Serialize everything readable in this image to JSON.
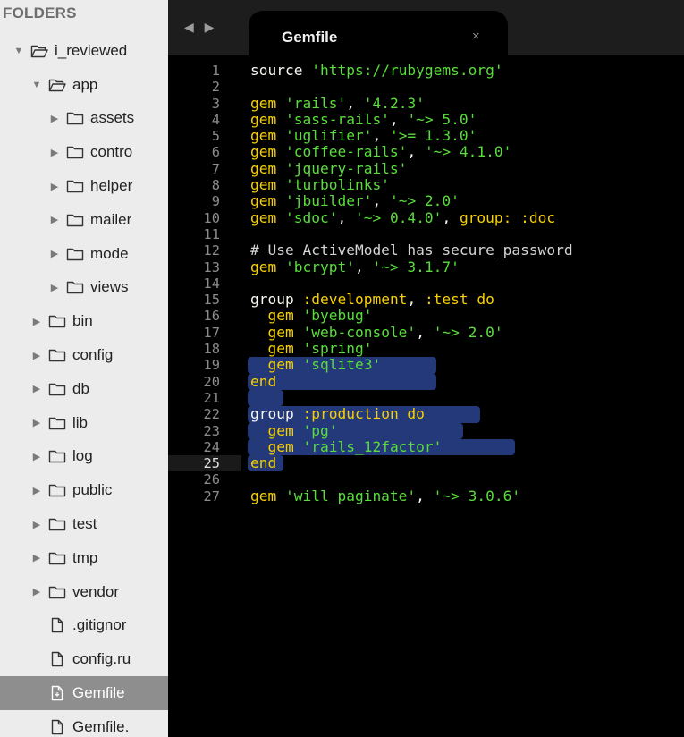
{
  "sidebar": {
    "header": "FOLDERS",
    "items": [
      {
        "label": "i_reviewed",
        "depth": 0,
        "kind": "folder-open",
        "expanded": true
      },
      {
        "label": "app",
        "depth": 1,
        "kind": "folder-open",
        "expanded": true
      },
      {
        "label": "assets",
        "depth": 2,
        "kind": "folder",
        "expanded": false
      },
      {
        "label": "contro",
        "depth": 2,
        "kind": "folder",
        "expanded": false
      },
      {
        "label": "helper",
        "depth": 2,
        "kind": "folder",
        "expanded": false
      },
      {
        "label": "mailer",
        "depth": 2,
        "kind": "folder",
        "expanded": false
      },
      {
        "label": "mode",
        "depth": 2,
        "kind": "folder",
        "expanded": false
      },
      {
        "label": "views",
        "depth": 2,
        "kind": "folder",
        "expanded": false
      },
      {
        "label": "bin",
        "depth": 1,
        "kind": "folder",
        "expanded": false
      },
      {
        "label": "config",
        "depth": 1,
        "kind": "folder",
        "expanded": false
      },
      {
        "label": "db",
        "depth": 1,
        "kind": "folder",
        "expanded": false
      },
      {
        "label": "lib",
        "depth": 1,
        "kind": "folder",
        "expanded": false
      },
      {
        "label": "log",
        "depth": 1,
        "kind": "folder",
        "expanded": false
      },
      {
        "label": "public",
        "depth": 1,
        "kind": "folder",
        "expanded": false
      },
      {
        "label": "test",
        "depth": 1,
        "kind": "folder",
        "expanded": false
      },
      {
        "label": "tmp",
        "depth": 1,
        "kind": "folder",
        "expanded": false
      },
      {
        "label": "vendor",
        "depth": 1,
        "kind": "folder",
        "expanded": false
      },
      {
        "label": ".gitignor",
        "depth": 1,
        "kind": "file"
      },
      {
        "label": "config.ru",
        "depth": 1,
        "kind": "file"
      },
      {
        "label": "Gemfile",
        "depth": 1,
        "kind": "file-active",
        "active": true
      },
      {
        "label": "Gemfile.",
        "depth": 1,
        "kind": "file"
      }
    ]
  },
  "editor": {
    "nav_arrows": "◀ ▶",
    "tab": {
      "title": "Gemfile",
      "close": "×"
    },
    "current_line": 25,
    "lines": [
      {
        "n": "1",
        "tokens": [
          [
            "plain",
            "source "
          ],
          [
            "str",
            "'https://rubygems.org'"
          ]
        ]
      },
      {
        "n": "2",
        "tokens": []
      },
      {
        "n": "3",
        "tokens": [
          [
            "kw",
            "gem "
          ],
          [
            "str",
            "'rails'"
          ],
          [
            "plain",
            ", "
          ],
          [
            "str",
            "'4.2.3'"
          ]
        ]
      },
      {
        "n": "4",
        "tokens": [
          [
            "kw",
            "gem "
          ],
          [
            "str",
            "'sass-rails'"
          ],
          [
            "plain",
            ", "
          ],
          [
            "str",
            "'~> 5.0'"
          ]
        ]
      },
      {
        "n": "5",
        "tokens": [
          [
            "kw",
            "gem "
          ],
          [
            "str",
            "'uglifier'"
          ],
          [
            "plain",
            ", "
          ],
          [
            "str",
            "'>= 1.3.0'"
          ]
        ]
      },
      {
        "n": "6",
        "tokens": [
          [
            "kw",
            "gem "
          ],
          [
            "str",
            "'coffee-rails'"
          ],
          [
            "plain",
            ", "
          ],
          [
            "str",
            "'~> 4.1.0'"
          ]
        ]
      },
      {
        "n": "7",
        "tokens": [
          [
            "kw",
            "gem "
          ],
          [
            "str",
            "'jquery-rails'"
          ]
        ]
      },
      {
        "n": "8",
        "tokens": [
          [
            "kw",
            "gem "
          ],
          [
            "str",
            "'turbolinks'"
          ]
        ]
      },
      {
        "n": "9",
        "tokens": [
          [
            "kw",
            "gem "
          ],
          [
            "str",
            "'jbuilder'"
          ],
          [
            "plain",
            ", "
          ],
          [
            "str",
            "'~> 2.0'"
          ]
        ]
      },
      {
        "n": "10",
        "tokens": [
          [
            "kw",
            "gem "
          ],
          [
            "str",
            "'sdoc'"
          ],
          [
            "plain",
            ", "
          ],
          [
            "str",
            "'~> 0.4.0'"
          ],
          [
            "plain",
            ", "
          ],
          [
            "sym",
            "group: :doc"
          ]
        ]
      },
      {
        "n": "11",
        "tokens": []
      },
      {
        "n": "12",
        "tokens": [
          [
            "cmt",
            "# Use ActiveModel has_secure_password"
          ]
        ]
      },
      {
        "n": "13",
        "tokens": [
          [
            "kw",
            "gem "
          ],
          [
            "str",
            "'bcrypt'"
          ],
          [
            "plain",
            ", "
          ],
          [
            "str",
            "'~> 3.1.7'"
          ]
        ]
      },
      {
        "n": "14",
        "tokens": []
      },
      {
        "n": "15",
        "tokens": [
          [
            "plain",
            "group "
          ],
          [
            "sym",
            ":development"
          ],
          [
            "plain",
            ", "
          ],
          [
            "sym",
            ":test"
          ],
          [
            "kw",
            " do"
          ]
        ]
      },
      {
        "n": "16",
        "tokens": [
          [
            "plain",
            "  "
          ],
          [
            "kw",
            "gem "
          ],
          [
            "str",
            "'byebug'"
          ]
        ]
      },
      {
        "n": "17",
        "tokens": [
          [
            "plain",
            "  "
          ],
          [
            "kw",
            "gem "
          ],
          [
            "str",
            "'web-console'"
          ],
          [
            "plain",
            ", "
          ],
          [
            "str",
            "'~> 2.0'"
          ]
        ]
      },
      {
        "n": "18",
        "tokens": [
          [
            "plain",
            "  "
          ],
          [
            "kw",
            "gem "
          ],
          [
            "str",
            "'spring'"
          ]
        ]
      },
      {
        "n": "19",
        "tokens": [
          [
            "plain",
            "  "
          ],
          [
            "kw",
            "gem "
          ],
          [
            "str",
            "'sqlite3'"
          ]
        ]
      },
      {
        "n": "20",
        "tokens": [
          [
            "kw",
            "end"
          ]
        ]
      },
      {
        "n": "21",
        "tokens": []
      },
      {
        "n": "22",
        "tokens": [
          [
            "plain",
            "group "
          ],
          [
            "sym",
            ":production"
          ],
          [
            "kw",
            " do"
          ]
        ]
      },
      {
        "n": "23",
        "tokens": [
          [
            "plain",
            "  "
          ],
          [
            "kw",
            "gem "
          ],
          [
            "str",
            "'pg'"
          ]
        ]
      },
      {
        "n": "24",
        "tokens": [
          [
            "plain",
            "  "
          ],
          [
            "kw",
            "gem "
          ],
          [
            "str",
            "'rails_12factor'"
          ]
        ]
      },
      {
        "n": "25",
        "tokens": [
          [
            "kw",
            "end"
          ]
        ]
      },
      {
        "n": "26",
        "tokens": []
      },
      {
        "n": "27",
        "tokens": [
          [
            "kw",
            "gem "
          ],
          [
            "str",
            "'will_paginate'"
          ],
          [
            "plain",
            ", "
          ],
          [
            "str",
            "'~> 3.0.6'"
          ]
        ]
      }
    ]
  }
}
